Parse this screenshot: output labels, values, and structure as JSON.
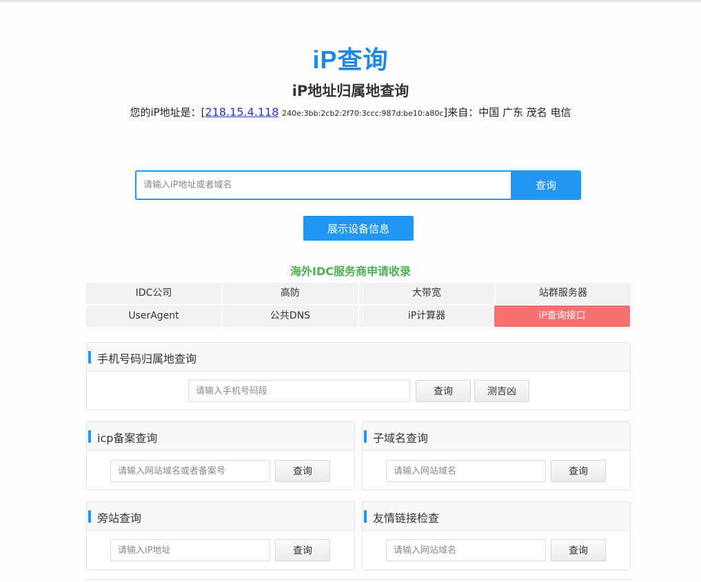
{
  "header": {
    "logo_ip": "iP",
    "logo_text": "查询",
    "subtitle": "iP地址归属地查询",
    "myip_prefix": "您的iP地址是：[",
    "myip_v4": "218.15.4.118",
    "myip_v6": "240e:3bb:2cb2:2f70:3ccc:987d:be10:a80c",
    "myip_suffix": "]来自：中国 广东 茂名 电信"
  },
  "search": {
    "placeholder": "请输入iP地址或者域名",
    "button": "查询"
  },
  "device_button": "展示设备信息",
  "idc": {
    "title": "海外IDC服务商申请收录",
    "items": [
      "IDC公司",
      "高防",
      "大带宽",
      "站群服务器",
      "UserAgent",
      "公共DNS",
      "iP计算器",
      "iP查询接口"
    ],
    "active_index": 7,
    "active_color": "#f87171"
  },
  "phone_panel": {
    "title": "手机号码归属地查询",
    "placeholder": "请输入手机号码段",
    "query_button": "查询",
    "fortune_button": "测吉凶"
  },
  "icp_panel": {
    "title": "icp备案查询",
    "placeholder": "请输入网站域名或者备案号",
    "button": "查询"
  },
  "subdomain_panel": {
    "title": "子域名查询",
    "placeholder": "请输入网站域名",
    "button": "查询"
  },
  "sidesite_panel": {
    "title": "旁站查询",
    "placeholder": "请输入iP地址",
    "button": "查询"
  },
  "friendlink_panel": {
    "title": "友情链接检查",
    "placeholder": "请输入网站域名",
    "button": "查询"
  },
  "colors": {
    "accent": "#2196f3",
    "idc_title": "#4caf50"
  }
}
